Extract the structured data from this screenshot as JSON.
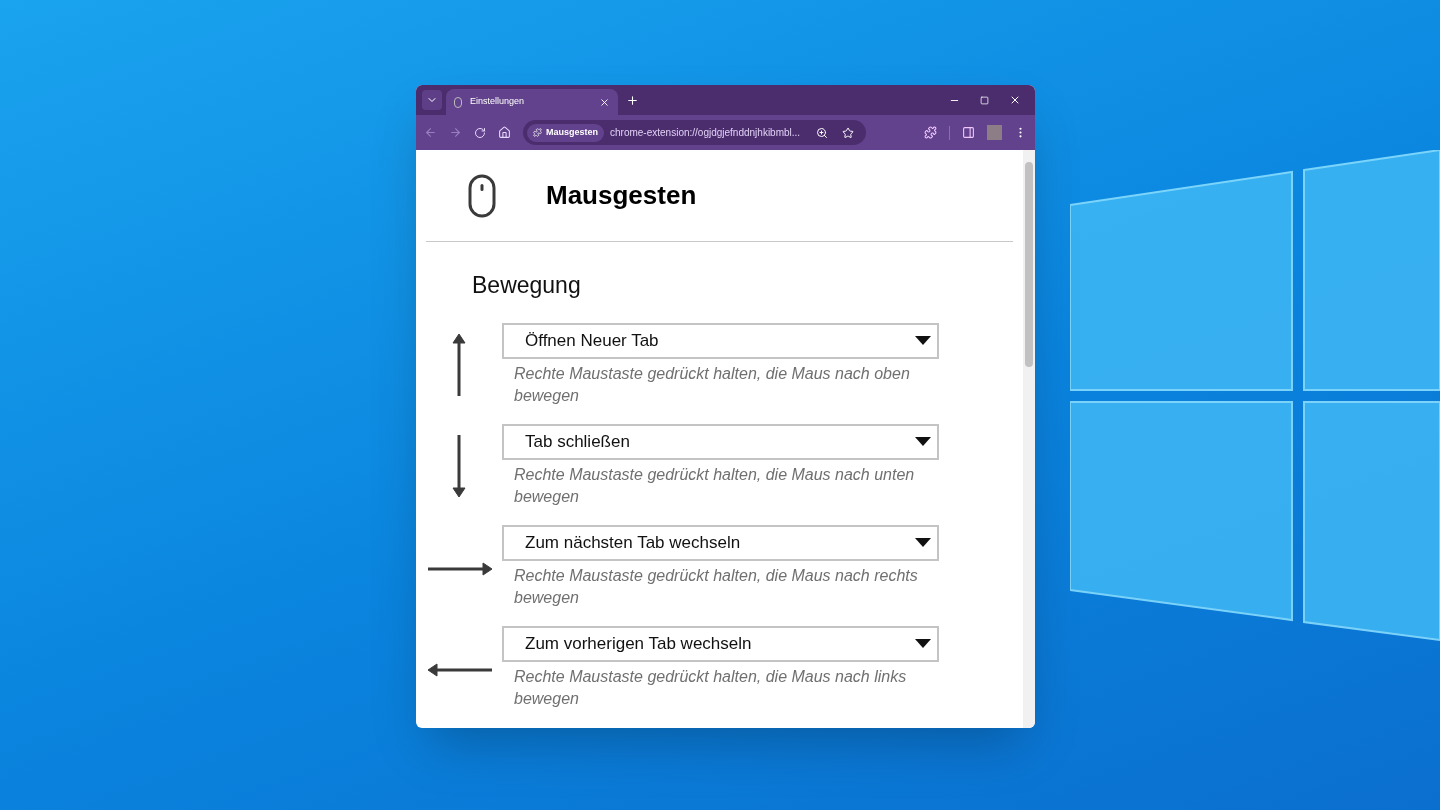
{
  "browser": {
    "tab_title": "Einstellungen",
    "site_chip": "Mausgesten",
    "url": "chrome-extension://ogjdgjefnddnjhkibmbl..."
  },
  "page": {
    "title": "Mausgesten",
    "section": "Bewegung",
    "gestures": [
      {
        "kind": "up",
        "action": "Öffnen Neuer Tab",
        "hint": "Rechte Maustaste gedrückt halten, die Maus nach oben bewegen"
      },
      {
        "kind": "down",
        "action": "Tab schließen",
        "hint": "Rechte Maustaste gedrückt halten, die Maus nach unten bewegen"
      },
      {
        "kind": "right",
        "action": "Zum nächsten Tab wechseln",
        "hint": "Rechte Maustaste gedrückt halten, die Maus nach rechts bewegen"
      },
      {
        "kind": "left",
        "action": "Zum vorherigen Tab wechseln",
        "hint": "Rechte Maustaste gedrückt halten, die Maus nach links bewegen"
      }
    ]
  }
}
